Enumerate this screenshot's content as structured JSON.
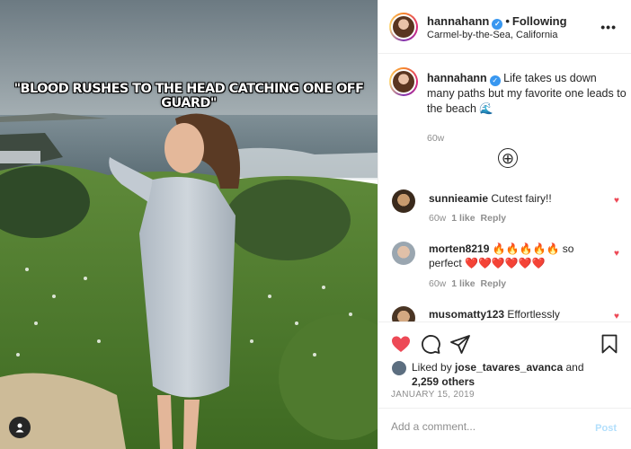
{
  "photo": {
    "overlay_caption": "\"BLOOD RUSHES TO THE HEAD CATCHING ONE OFF GUARD\"",
    "user_tag_icon": "user-icon"
  },
  "header": {
    "username": "hannahann",
    "separator": "•",
    "follow_status": "Following",
    "location": "Carmel-by-the-Sea, California",
    "more_icon": "•••"
  },
  "caption": {
    "username": "hannahann",
    "text": "Life takes us down many paths but my favorite one leads to the beach 🌊",
    "time": "60w"
  },
  "load_more_icon": "⊕",
  "comments": [
    {
      "username": "sunnieamie",
      "text": "Cutest fairy!!",
      "time": "60w",
      "likes": "1 like",
      "reply": "Reply"
    },
    {
      "username": "morten8219",
      "text": "🔥🔥🔥🔥🔥 so perfect ❤️❤️❤️❤️❤️❤️",
      "time": "60w",
      "likes": "1 like",
      "reply": "Reply"
    },
    {
      "username": "musomatty123",
      "text": "Effortlessly",
      "time": "",
      "likes": "",
      "reply": ""
    }
  ],
  "actions": {
    "icons": [
      "heart-icon",
      "comment-icon",
      "share-icon",
      "bookmark-icon"
    ],
    "liked_by_prefix": "Liked by",
    "liked_by_user": "jose_tavares_avanca",
    "liked_by_and": "and",
    "others": "2,259 others",
    "date": "JANUARY 15, 2019"
  },
  "add_comment": {
    "placeholder": "Add a comment...",
    "post_label": "Post"
  },
  "colors": {
    "like_red": "#ed4956",
    "verified_blue": "#3897f0",
    "post_disabled": "#b2dffc"
  }
}
